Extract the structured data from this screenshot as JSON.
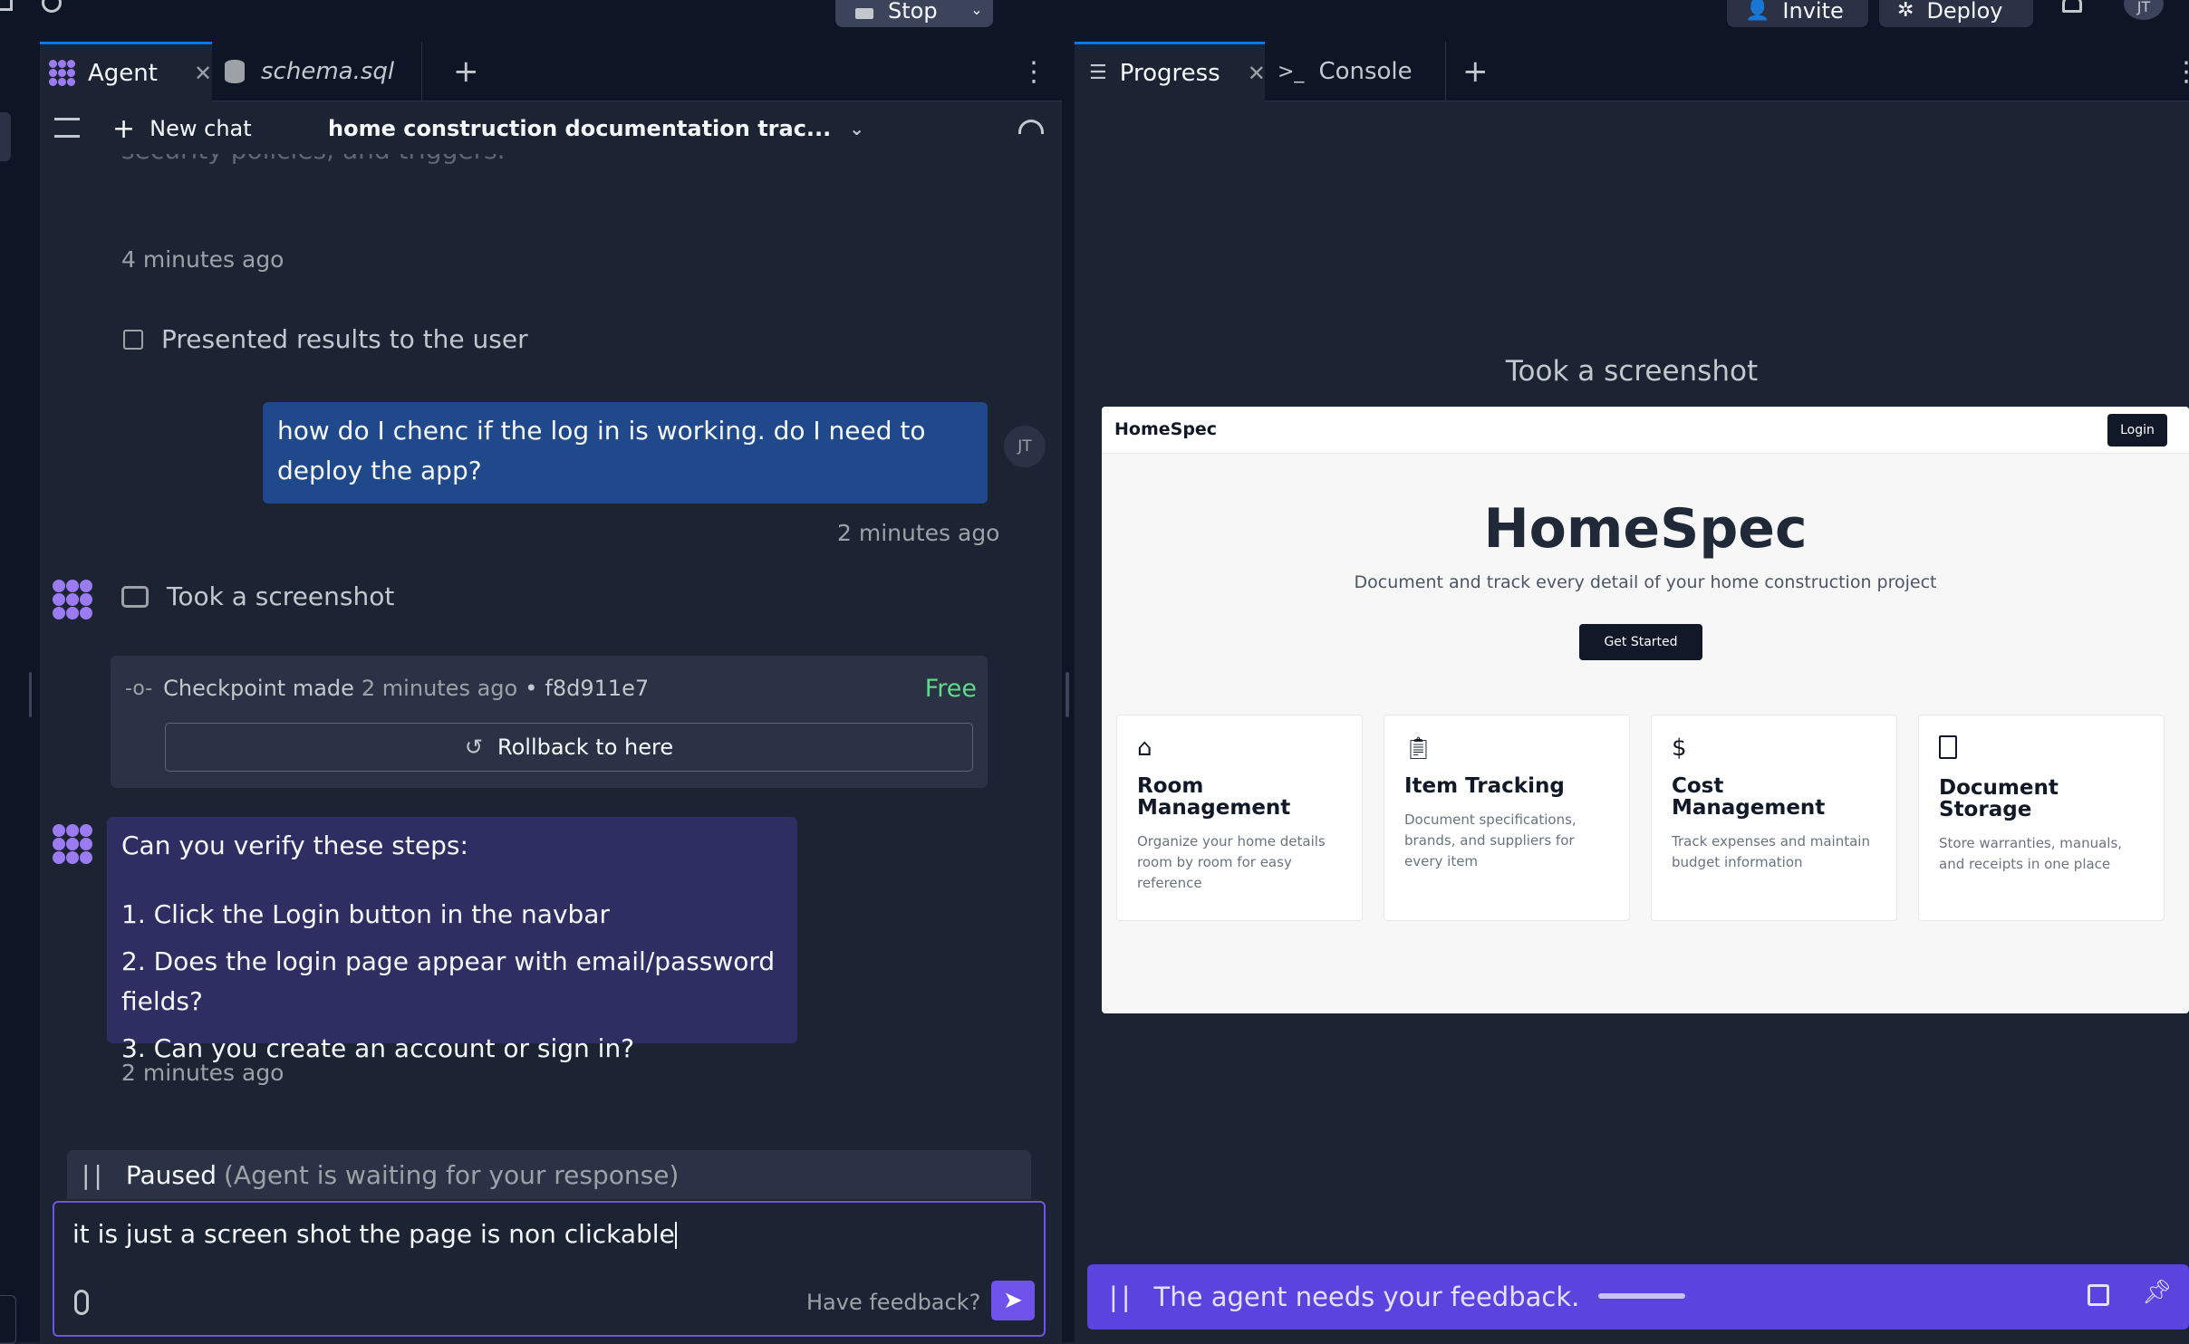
{
  "topbar": {
    "stop_label": "Stop",
    "invite_label": "Invite",
    "deploy_label": "Deploy",
    "avatar_initials": "JT"
  },
  "left_tabs": [
    {
      "label": "Agent"
    },
    {
      "label": "schema.sql"
    }
  ],
  "chat_header": {
    "new_chat_label": "New chat",
    "chat_title": "home construction documentation trac..."
  },
  "messages": {
    "faded_text": "security policies, and triggers.",
    "ts1": "4 minutes ago",
    "presented_label": "Presented results to the user",
    "user_message": "how do I chenc if the log in is working. do I need to deploy the app?",
    "user_initials": "JT",
    "ts2": "2 minutes ago",
    "screenshot_action": "Took a screenshot",
    "checkpoint_label": "Checkpoint made",
    "checkpoint_time": "2 minutes ago",
    "checkpoint_sep": "•",
    "checkpoint_hash": "f8d911e7",
    "checkpoint_cost": "Free",
    "rollback_label": "Rollback to here",
    "agent_intro": "Can you verify these steps:",
    "agent_steps": [
      "1. Click the Login button in the navbar",
      "2. Does the login page appear with email/password fields?",
      "3. Can you create an account or sign in?"
    ],
    "ts3": "2 minutes ago"
  },
  "paused": {
    "label": "Paused",
    "reason": "(Agent is waiting for your response)"
  },
  "composer": {
    "value": "it is just a screen shot the page is non clickable",
    "feedback_label": "Have feedback?"
  },
  "right_tabs": [
    {
      "label": "Progress"
    },
    {
      "label": "Console"
    }
  ],
  "progress": {
    "heading": "Took a screenshot",
    "feedback_banner": "The agent needs your feedback."
  },
  "homespec": {
    "brand": "HomeSpec",
    "login_label": "Login",
    "hero_title": "HomeSpec",
    "hero_subtitle": "Document and track every detail of your home construction project",
    "cta_label": "Get Started",
    "features": [
      {
        "icon": "home-icon",
        "title": "Room Management",
        "desc": "Organize your home details room by room for easy reference"
      },
      {
        "icon": "clipboard-icon",
        "title": "Item Tracking",
        "desc": "Document specifications, brands, and suppliers for every item"
      },
      {
        "icon": "dollar-icon",
        "title": "Cost Management",
        "desc": "Track expenses and maintain budget information"
      },
      {
        "icon": "document-icon",
        "title": "Document Storage",
        "desc": "Store warranties, manuals, and receipts in one place"
      }
    ]
  },
  "colors": {
    "accent": "#0079f2",
    "agent_purple": "#9b7cf0",
    "feedback_bar": "#5b43e0",
    "free_green": "#5fd98a",
    "user_bubble": "#20498c",
    "agent_bubble": "#2e2e63"
  }
}
